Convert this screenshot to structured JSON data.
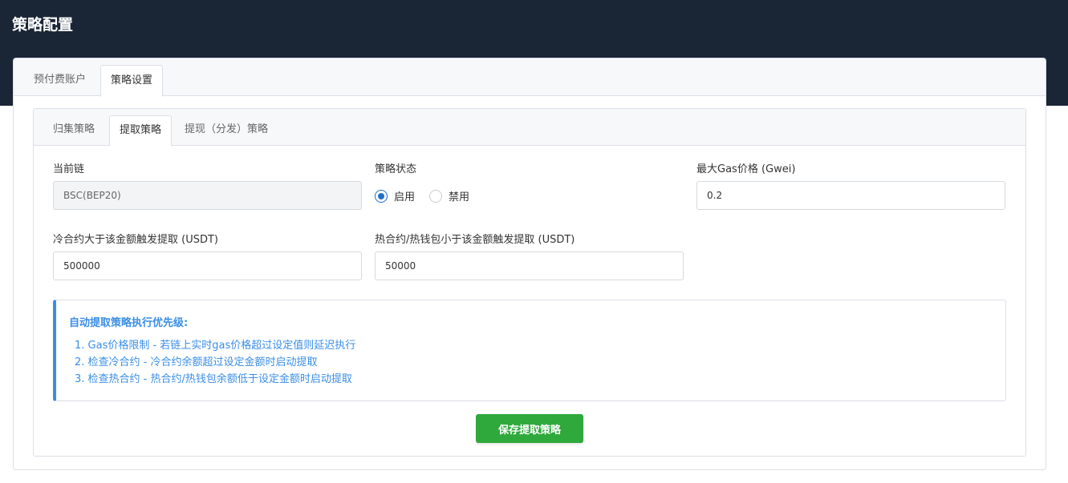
{
  "page": {
    "title": "策略配置"
  },
  "outer_tabs": [
    {
      "label": "预付费账户",
      "active": false
    },
    {
      "label": "策略设置",
      "active": true
    }
  ],
  "inner_tabs": [
    {
      "label": "归集策略",
      "active": false
    },
    {
      "label": "提取策略",
      "active": true
    },
    {
      "label": "提现（分发）策略",
      "active": false
    }
  ],
  "form": {
    "current_chain": {
      "label": "当前链",
      "value": "BSC(BEP20)",
      "disabled": true
    },
    "strategy_status": {
      "label": "策略状态",
      "options": [
        {
          "label": "启用",
          "checked": true
        },
        {
          "label": "禁用",
          "checked": false
        }
      ]
    },
    "max_gas": {
      "label": "最大Gas价格 (Gwei)",
      "value": "0.2"
    },
    "cold_threshold": {
      "label": "冷合约大于该金额触发提取 (USDT)",
      "value": "500000"
    },
    "hot_threshold": {
      "label": "热合约/热钱包小于该金额触发提取 (USDT)",
      "value": "50000"
    }
  },
  "info": {
    "title": "自动提取策略执行优先级:",
    "items": [
      "1. Gas价格限制 - 若链上实时gas价格超过设定值则延迟执行",
      "2. 检查冷合约 - 冷合约余额超过设定金额时启动提取",
      "3. 检查热合约 - 热合约/热钱包余额低于设定金额时启动提取"
    ]
  },
  "actions": {
    "save_label": "保存提取策略"
  },
  "colors": {
    "header_bg": "#1a2536",
    "accent": "#3a8ee6",
    "save_button": "#2fa83c"
  }
}
